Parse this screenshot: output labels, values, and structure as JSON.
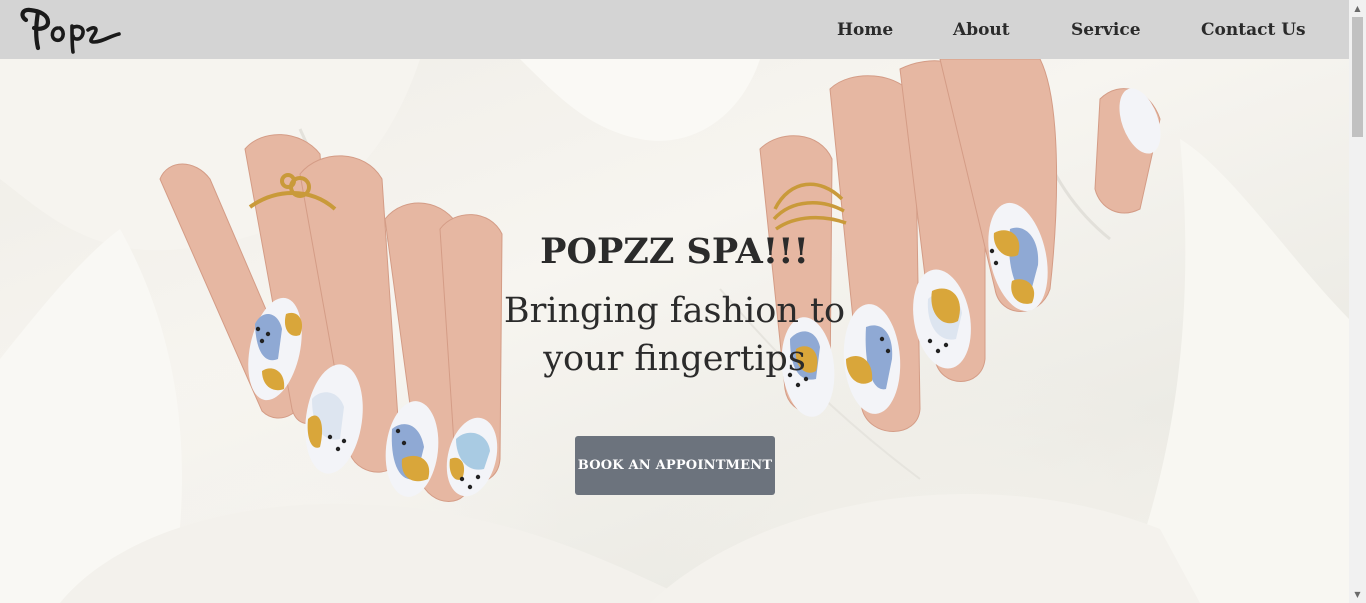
{
  "header": {
    "logo_text": "Popz",
    "nav": [
      {
        "label": "Home"
      },
      {
        "label": "About"
      },
      {
        "label": "Service"
      },
      {
        "label": "Contact Us"
      }
    ]
  },
  "hero": {
    "title": "POPZZ SPA!!!",
    "tagline": "Bringing fashion to your fingertips",
    "cta_label": "BOOK AN APPOINTMENT",
    "background_image": "hands-with-painted-nails-and-gold-rings-on-white-fabric"
  },
  "scrollbar": {
    "up_icon": "triangle-up",
    "down_icon": "triangle-down"
  },
  "colors": {
    "header_bg": "#d4d4d4",
    "cta_bg": "#6c737d",
    "text": "#2b2b2b",
    "nail_blue": "#8fa9d4",
    "nail_gold": "#d9a63a",
    "skin": "#e8b9a4"
  }
}
